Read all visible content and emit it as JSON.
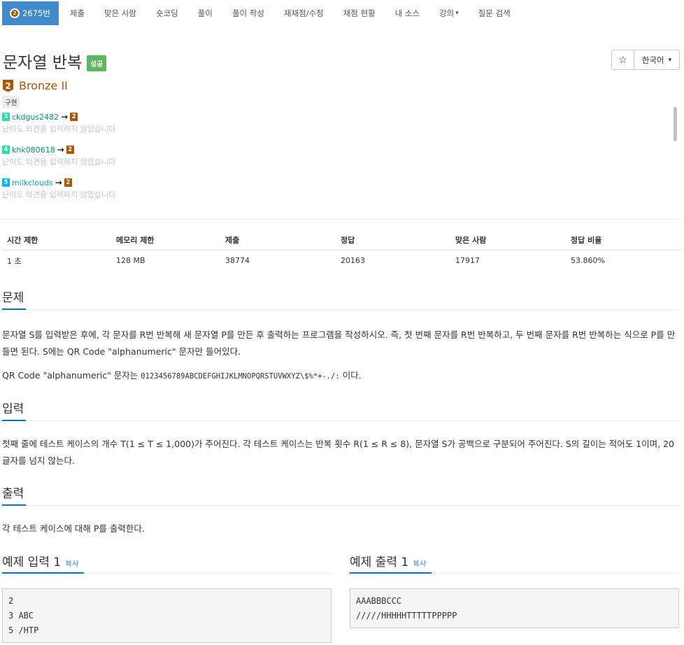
{
  "nav": {
    "problem_label": "2675번",
    "items": [
      "제출",
      "맞은 사람",
      "숏코딩",
      "풀이",
      "풀이 작성",
      "재채점/수정",
      "채점 현황",
      "내 소스",
      "강의",
      "질문 검색"
    ]
  },
  "problem": {
    "title": "문자열 반복",
    "result_label": "성공",
    "star_icon": "☆",
    "language": "한국어",
    "tier_level": "2",
    "tier_name": "Bronze II",
    "tag": "구현"
  },
  "opinions": [
    {
      "from_level": "3",
      "user": "ckdgus2482",
      "to_level": "2",
      "text": "난이도 의견을 입력하지 않았습니다"
    },
    {
      "from_level": "4",
      "user": "khk080618",
      "to_level": "2",
      "text": "난이도 의견을 입력하지 않았습니다"
    },
    {
      "from_level": "5",
      "user": "milkclouds",
      "to_level": "2",
      "text": "난이도 의견을 입력하지 않았습니다"
    }
  ],
  "info": {
    "headers": [
      "시간 제한",
      "메모리 제한",
      "제출",
      "정답",
      "맞은 사람",
      "정답 비율"
    ],
    "values": [
      "1 초",
      "128 MB",
      "38774",
      "20163",
      "17917",
      "53.860%"
    ]
  },
  "sections": {
    "problem_title": "문제",
    "problem_text_1": "문자열 S를 입력받은 후에, 각 문자를 R번 반복해 새 문자열 P를 만든 후 출력하는 프로그램을 작성하시오. 즉, 첫 번째 문자를 R번 반복하고, 두 번째 문자를 R번 반복하는 식으로 P를 만들면 된다. S에는 QR Code \"alphanumeric\" 문자만 들어있다.",
    "problem_text_2_prefix": "QR Code \"alphanumeric\" 문자는",
    "problem_text_2_code": "0123456789ABCDEFGHIJKLMNOPQRSTUVWXYZ\\$%*+-./:",
    "problem_text_2_suffix": "이다.",
    "input_title": "입력",
    "input_text": "첫째 줄에 테스트 케이스의 개수 T(1 ≤ T ≤ 1,000)가 주어진다. 각 테스트 케이스는 반복 횟수 R(1 ≤ R ≤ 8), 문자열 S가 공백으로 구분되어 주어진다. S의 길이는 적어도 1이며, 20글자를 넘지 않는다.",
    "output_title": "출력",
    "output_text": "각 테스트 케이스에 대해 P를 출력한다."
  },
  "samples": {
    "input_title": "예제 입력 1",
    "output_title": "예제 출력 1",
    "copy_label": "복사",
    "input": "2\n3 ABC\n5 /HTP",
    "output": "AAABBBCCC\n/////HHHHHTTTTTPPPPP"
  }
}
